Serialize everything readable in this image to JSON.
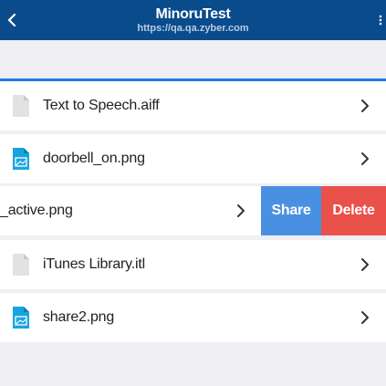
{
  "header": {
    "title": "MinoruTest",
    "subtitle": "https://qa.qa.zyber.com",
    "back_icon": "chevron-left-icon",
    "more_icon": "vertical-ellipsis-icon",
    "background_color": "#0a4b8c"
  },
  "files": [
    {
      "name": "Text to Speech.aiff",
      "icon": "generic-file-icon"
    },
    {
      "name": "doorbell_on.png",
      "icon": "image-file-icon"
    },
    {
      "name": "_active.png",
      "icon": "image-file-icon",
      "swiped": true
    },
    {
      "name": "iTunes Library.itl",
      "icon": "generic-file-icon"
    },
    {
      "name": "share2.png",
      "icon": "image-file-icon"
    }
  ],
  "row_actions": {
    "share_label": "Share",
    "delete_label": "Delete",
    "share_color": "#4a90e2",
    "delete_color": "#e9514a"
  },
  "colors": {
    "accent": "#1a7fe0",
    "image_icon": "#18a4e0",
    "generic_icon": "#e2e2e2"
  }
}
